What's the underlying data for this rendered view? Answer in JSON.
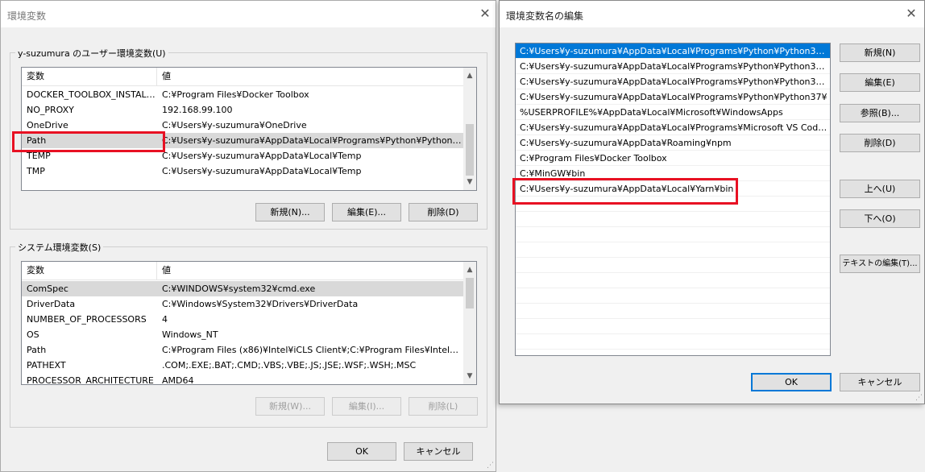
{
  "env_dialog": {
    "title": "環境変数",
    "user_group_label": "y-suzumura のユーザー環境変数(U)",
    "system_group_label": "システム環境変数(S)",
    "col_variable": "変数",
    "col_value": "値",
    "user_vars": [
      {
        "name": "DOCKER_TOOLBOX_INSTALL...",
        "value": "C:¥Program Files¥Docker Toolbox"
      },
      {
        "name": "NO_PROXY",
        "value": "192.168.99.100"
      },
      {
        "name": "OneDrive",
        "value": "C:¥Users¥y-suzumura¥OneDrive"
      },
      {
        "name": "Path",
        "value": "C:¥Users¥y-suzumura¥AppData¥Local¥Programs¥Python¥Python37..."
      },
      {
        "name": "TEMP",
        "value": "C:¥Users¥y-suzumura¥AppData¥Local¥Temp"
      },
      {
        "name": "TMP",
        "value": "C:¥Users¥y-suzumura¥AppData¥Local¥Temp"
      }
    ],
    "system_vars": [
      {
        "name": "ComSpec",
        "value": "C:¥WINDOWS¥system32¥cmd.exe"
      },
      {
        "name": "DriverData",
        "value": "C:¥Windows¥System32¥Drivers¥DriverData"
      },
      {
        "name": "NUMBER_OF_PROCESSORS",
        "value": "4"
      },
      {
        "name": "OS",
        "value": "Windows_NT"
      },
      {
        "name": "Path",
        "value": "C:¥Program Files (x86)¥Intel¥iCLS Client¥;C:¥Program Files¥Intel¥iCL..."
      },
      {
        "name": "PATHEXT",
        "value": ".COM;.EXE;.BAT;.CMD;.VBS;.VBE;.JS;.JSE;.WSF;.WSH;.MSC"
      },
      {
        "name": "PROCESSOR_ARCHITECTURE",
        "value": "AMD64"
      }
    ],
    "user_buttons": {
      "new": "新規(N)...",
      "edit": "編集(E)...",
      "delete": "削除(D)"
    },
    "system_buttons": {
      "new": "新規(W)...",
      "edit": "編集(I)...",
      "delete": "削除(L)"
    },
    "ok": "OK",
    "cancel": "キャンセル"
  },
  "edit_dialog": {
    "title": "環境変数名の編集",
    "entries": [
      "C:¥Users¥y-suzumura¥AppData¥Local¥Programs¥Python¥Python37-32...",
      "C:¥Users¥y-suzumura¥AppData¥Local¥Programs¥Python¥Python37-32¥",
      "C:¥Users¥y-suzumura¥AppData¥Local¥Programs¥Python¥Python37¥S...",
      "C:¥Users¥y-suzumura¥AppData¥Local¥Programs¥Python¥Python37¥",
      "%USERPROFILE%¥AppData¥Local¥Microsoft¥WindowsApps",
      "C:¥Users¥y-suzumura¥AppData¥Local¥Programs¥Microsoft VS Code¥bin",
      "C:¥Users¥y-suzumura¥AppData¥Roaming¥npm",
      "C:¥Program Files¥Docker Toolbox",
      "C:¥MinGW¥bin",
      "C:¥Users¥y-suzumura¥AppData¥Local¥Yarn¥bin"
    ],
    "buttons": {
      "new": "新規(N)",
      "edit": "編集(E)",
      "browse": "参照(B)...",
      "delete": "削除(D)",
      "up": "上へ(U)",
      "down": "下へ(O)",
      "edit_text": "テキストの編集(T)..."
    },
    "ok": "OK",
    "cancel": "キャンセル"
  },
  "colors": {
    "highlight_box": "#e81123",
    "selection": "#0078d7"
  }
}
